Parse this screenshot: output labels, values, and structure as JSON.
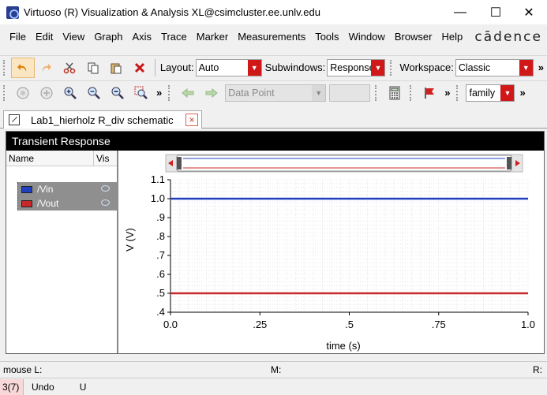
{
  "window": {
    "title": "Virtuoso (R) Visualization & Analysis XL@csimcluster.ee.unlv.edu",
    "minimize": "—",
    "maximize": "☐",
    "close": "✕"
  },
  "menu": [
    "File",
    "Edit",
    "View",
    "Graph",
    "Axis",
    "Trace",
    "Marker",
    "Measurements",
    "Tools",
    "Window",
    "Browser",
    "Help"
  ],
  "brand": "cādence",
  "toolbar1": {
    "layout_label": "Layout:",
    "layout_value": "Auto",
    "subwindows_label": "Subwindows:",
    "subwindows_value": "Response",
    "workspace_label": "Workspace:",
    "workspace_value": "Classic",
    "more": "»"
  },
  "toolbar2": {
    "data_point_value": "Data Point",
    "family_value": "family",
    "more": "»"
  },
  "tab": {
    "label": "Lab1_hierholz R_div schematic",
    "close": "×"
  },
  "graph": {
    "title": "Transient Response",
    "legend_headers": {
      "name": "Name",
      "vis": "Vis"
    },
    "traces": [
      {
        "name": "/Vin",
        "color": "#1f3fbf"
      },
      {
        "name": "/Vout",
        "color": "#c82828"
      }
    ]
  },
  "chart_data": {
    "type": "line",
    "title": "",
    "xlabel": "time (s)",
    "ylabel": "V (V)",
    "xlim": [
      0.0,
      1.0
    ],
    "ylim": [
      0.4,
      1.1
    ],
    "x_ticks": [
      "0.0",
      ".25",
      ".5",
      ".75",
      "1.0"
    ],
    "y_ticks": [
      ".4",
      ".5",
      ".6",
      ".7",
      ".8",
      ".9",
      "1.0",
      "1.1"
    ],
    "grid": true,
    "series": [
      {
        "name": "/Vin",
        "color": "#1f3fbf",
        "x": [
          0.0,
          1.0
        ],
        "y": [
          1.0,
          1.0
        ]
      },
      {
        "name": "/Vout",
        "color": "#c82828",
        "x": [
          0.0,
          1.0
        ],
        "y": [
          0.5,
          0.5
        ]
      }
    ]
  },
  "status": {
    "mouse": "mouse L:",
    "middle": "M:",
    "right": "R:",
    "count": "3(7)",
    "undo": "Undo",
    "u": "U"
  }
}
